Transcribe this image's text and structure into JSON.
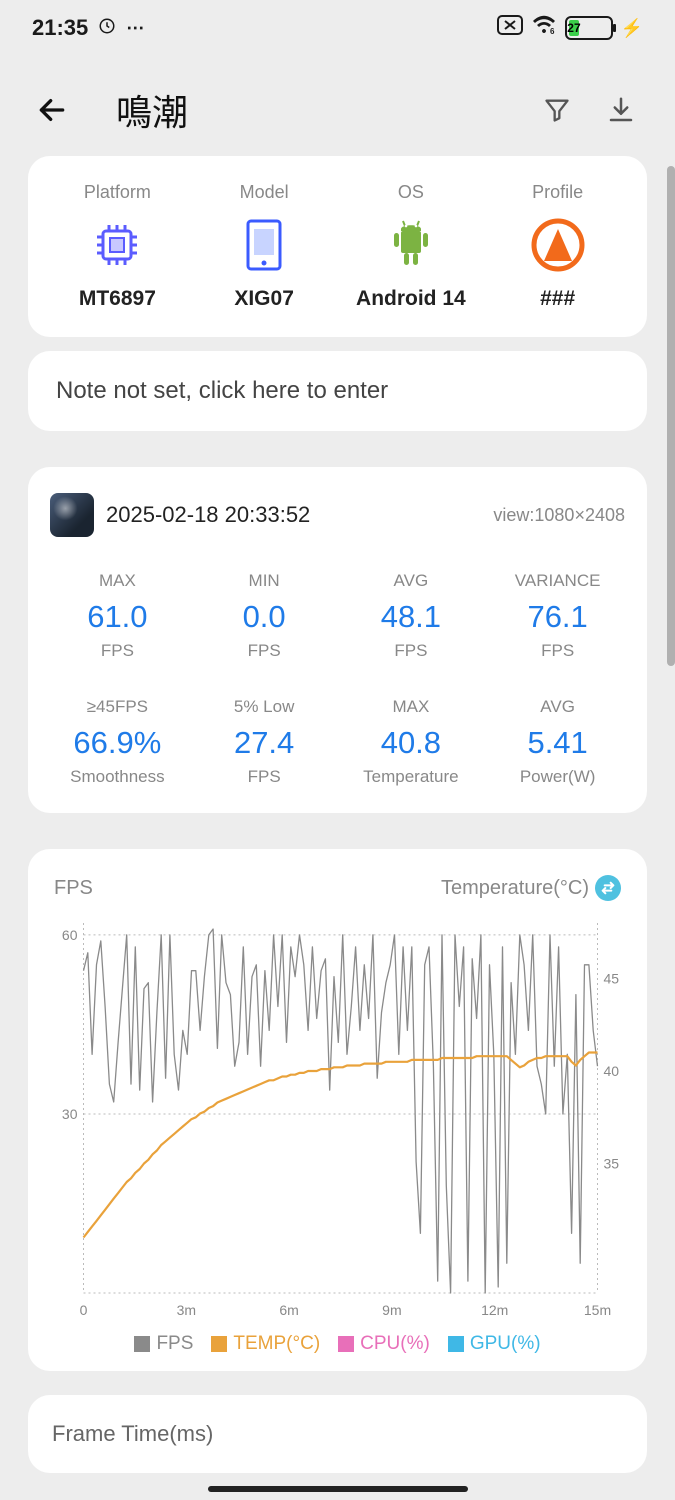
{
  "status": {
    "time": "21:35",
    "battery_pct": 27
  },
  "header": {
    "title": "鳴潮"
  },
  "device": {
    "platform_label": "Platform",
    "platform_value": "MT6897",
    "model_label": "Model",
    "model_value": "XIG07",
    "os_label": "OS",
    "os_value": "Android 14",
    "profile_label": "Profile",
    "profile_value": "###"
  },
  "note_placeholder": "Note not set, click here to enter",
  "session": {
    "timestamp": "2025-02-18 20:33:52",
    "view_label": "view:1080×2408",
    "stats": [
      {
        "top": "MAX",
        "value": "61.0",
        "bottom": "FPS"
      },
      {
        "top": "MIN",
        "value": "0.0",
        "bottom": "FPS"
      },
      {
        "top": "AVG",
        "value": "48.1",
        "bottom": "FPS"
      },
      {
        "top": "VARIANCE",
        "value": "76.1",
        "bottom": "FPS"
      },
      {
        "top": "≥45FPS",
        "value": "66.9%",
        "bottom": "Smoothness"
      },
      {
        "top": "5% Low",
        "value": "27.4",
        "bottom": "FPS"
      },
      {
        "top": "MAX",
        "value": "40.8",
        "bottom": "Temperature"
      },
      {
        "top": "AVG",
        "value": "5.41",
        "bottom": "Power(W)"
      }
    ]
  },
  "chart": {
    "left_label": "FPS",
    "right_label": "Temperature(°C)",
    "legend": {
      "fps": "FPS",
      "temp": "TEMP(°C)",
      "cpu": "CPU(%)",
      "gpu": "GPU(%)"
    },
    "colors": {
      "fps": "#8a8a8a",
      "temp": "#e9a23b",
      "cpu": "#e86fb9",
      "gpu": "#3fb8e6"
    }
  },
  "chart_data": {
    "type": "line",
    "x_ticks": [
      "0",
      "3m",
      "6m",
      "9m",
      "12m",
      "15m"
    ],
    "y_left_ticks": [
      30,
      60
    ],
    "y_right_ticks": [
      35,
      40,
      45
    ],
    "y_left_range": [
      0,
      62
    ],
    "y_right_range": [
      28,
      48
    ],
    "x_range_minutes": [
      0,
      15
    ],
    "series": [
      {
        "name": "FPS",
        "axis": "left",
        "values": [
          54,
          57,
          40,
          55,
          59,
          48,
          35,
          32,
          42,
          51,
          60,
          35,
          58,
          34,
          51,
          52,
          32,
          47,
          60,
          36,
          60,
          40,
          34,
          44,
          40,
          54,
          54,
          44,
          53,
          60,
          61,
          41,
          60,
          52,
          50,
          38,
          42,
          58,
          40,
          53,
          55,
          38,
          54,
          44,
          60,
          48,
          60,
          42,
          58,
          53,
          60,
          55,
          44,
          58,
          46,
          54,
          56,
          34,
          53,
          42,
          60,
          40,
          48,
          58,
          44,
          55,
          46,
          60,
          36,
          47,
          52,
          55,
          60,
          40,
          58,
          44,
          58,
          22,
          10,
          55,
          58,
          38,
          2,
          60,
          18,
          0,
          60,
          48,
          58,
          2,
          56,
          46,
          60,
          0,
          55,
          40,
          1,
          58,
          5,
          52,
          40,
          60,
          55,
          44,
          60,
          38,
          35,
          30,
          60,
          38,
          58,
          30,
          40,
          10,
          50,
          5,
          55,
          55,
          44,
          38
        ]
      },
      {
        "name": "TEMP(°C)",
        "axis": "right",
        "values": [
          31.0,
          31.3,
          31.6,
          31.9,
          32.2,
          32.5,
          32.8,
          33.1,
          33.4,
          33.7,
          34.0,
          34.2,
          34.5,
          34.7,
          35.0,
          35.2,
          35.5,
          35.7,
          36.0,
          36.2,
          36.4,
          36.6,
          36.8,
          37.0,
          37.2,
          37.4,
          37.5,
          37.7,
          37.8,
          38.0,
          38.1,
          38.3,
          38.4,
          38.5,
          38.6,
          38.7,
          38.8,
          38.9,
          39.0,
          39.1,
          39.2,
          39.3,
          39.4,
          39.5,
          39.5,
          39.6,
          39.7,
          39.7,
          39.8,
          39.8,
          39.9,
          39.9,
          40.0,
          40.0,
          40.0,
          40.1,
          40.1,
          40.1,
          40.2,
          40.2,
          40.2,
          40.3,
          40.3,
          40.3,
          40.3,
          40.4,
          40.4,
          40.4,
          40.4,
          40.4,
          40.5,
          40.5,
          40.5,
          40.5,
          40.5,
          40.5,
          40.6,
          40.6,
          40.6,
          40.6,
          40.6,
          40.6,
          40.6,
          40.7,
          40.7,
          40.7,
          40.7,
          40.7,
          40.7,
          40.7,
          40.7,
          40.8,
          40.8,
          40.8,
          40.8,
          40.8,
          40.8,
          40.8,
          40.8,
          40.6,
          40.4,
          40.2,
          40.3,
          40.5,
          40.6,
          40.7,
          40.7,
          40.8,
          40.8,
          40.8,
          40.8,
          40.8,
          40.8,
          40.5,
          40.3,
          40.6,
          40.8,
          41.0,
          41.0,
          41.0
        ]
      }
    ]
  },
  "next_section_title": "Frame Time(ms)"
}
